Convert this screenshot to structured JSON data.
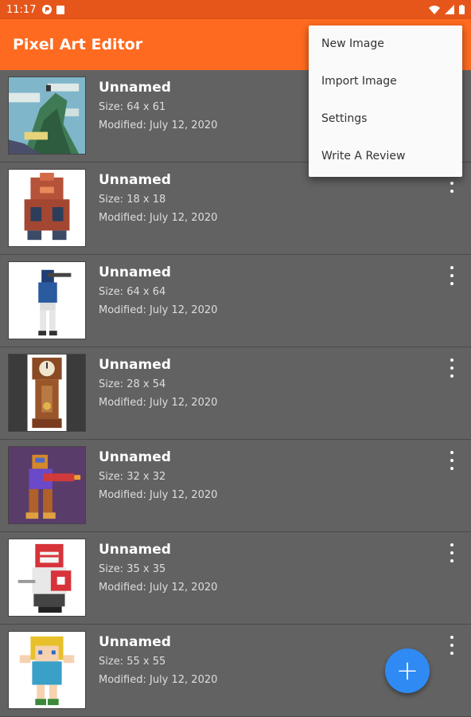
{
  "status_bar": {
    "time": "11:17",
    "left_icons": [
      "p-icon",
      "clipboard-icon"
    ],
    "right_icons": [
      "wifi-icon",
      "signal-icon",
      "battery-icon"
    ]
  },
  "app_bar": {
    "title": "Pixel Art Editor",
    "color": "#fe6a1f"
  },
  "overflow_menu": {
    "items": [
      "New Image",
      "Import Image",
      "Settings",
      "Write A Review"
    ]
  },
  "images": [
    {
      "name": "Unnamed",
      "size": "Size: 64 x 61",
      "modified": "Modified: July 12, 2020",
      "thumb": "landscape"
    },
    {
      "name": "Unnamed",
      "size": "Size: 18 x 18",
      "modified": "Modified: July 12, 2020",
      "thumb": "robot"
    },
    {
      "name": "Unnamed",
      "size": "Size: 64 x 64",
      "modified": "Modified: July 12, 2020",
      "thumb": "soldier"
    },
    {
      "name": "Unnamed",
      "size": "Size: 28 x 54",
      "modified": "Modified: July 12, 2020",
      "thumb": "clock"
    },
    {
      "name": "Unnamed",
      "size": "Size: 32 x 32",
      "modified": "Modified: July 12, 2020",
      "thumb": "blaster"
    },
    {
      "name": "Unnamed",
      "size": "Size: 35 x 35",
      "modified": "Modified: July 12, 2020",
      "thumb": "knight"
    },
    {
      "name": "Unnamed",
      "size": "Size: 55 x 55",
      "modified": "Modified: July 12, 2020",
      "thumb": "girl"
    }
  ],
  "fab": {
    "label": "+",
    "color": "#2f8af4"
  }
}
